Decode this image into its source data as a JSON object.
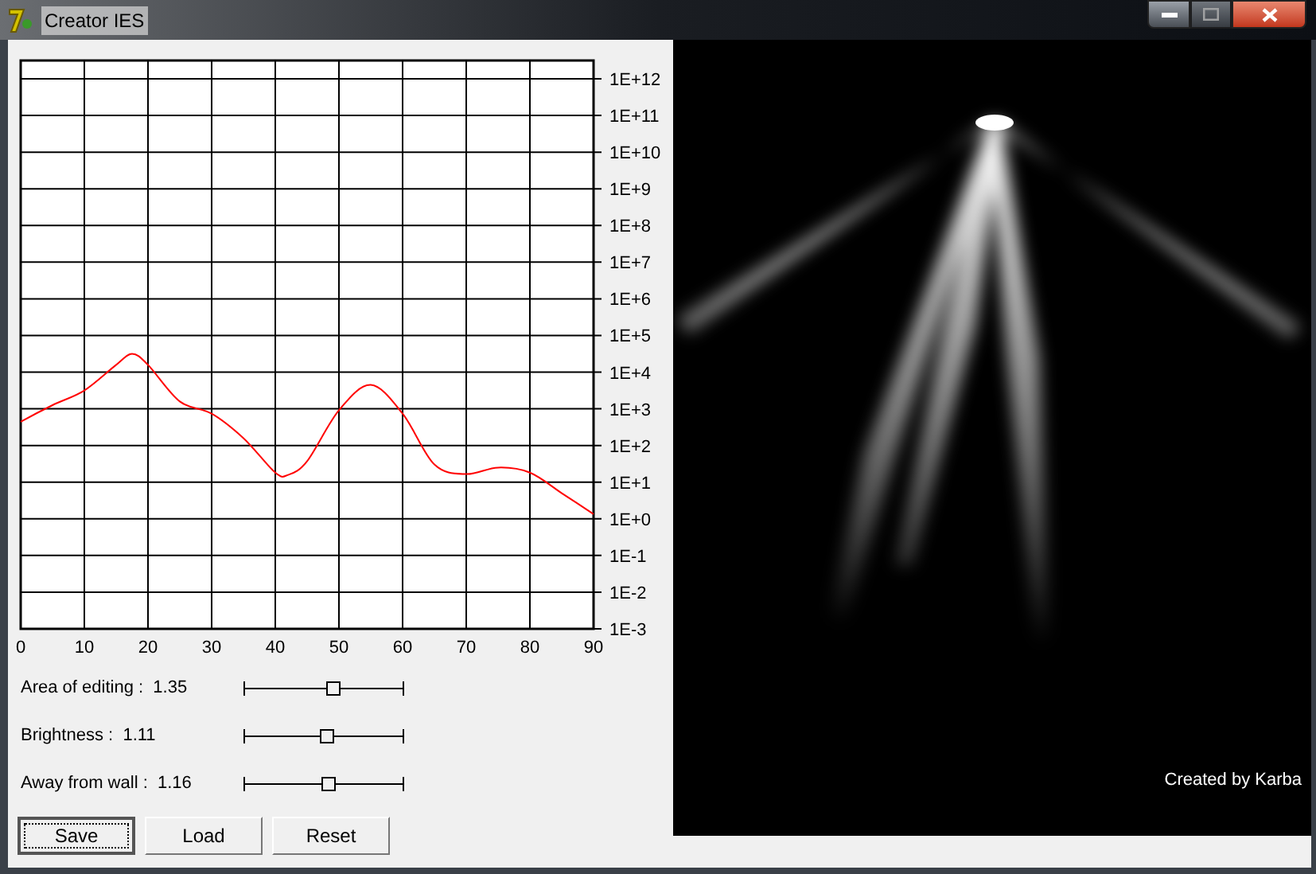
{
  "window": {
    "title": "Creator IES"
  },
  "title_buttons": [
    {
      "kind": "minimize"
    },
    {
      "kind": "maximize"
    },
    {
      "kind": "close"
    }
  ],
  "graph": {
    "x_labels": [
      "0",
      "10",
      "20",
      "30",
      "40",
      "50",
      "60",
      "70",
      "80",
      "90"
    ],
    "y_labels": [
      "1E+12",
      "1E+11",
      "1E+10",
      "1E+9",
      "1E+8",
      "1E+7",
      "1E+6",
      "1E+5",
      "1E+4",
      "1E+3",
      "1E+2",
      "1E+1",
      "1E+0",
      "1E-1",
      "1E-2",
      "1E-3"
    ]
  },
  "sliders": [
    {
      "label": "Area of editing :",
      "value": "1.35",
      "level": 0.56
    },
    {
      "label": "Brightness :",
      "value": "1.11",
      "level": 0.52
    },
    {
      "label": "Away from wall :",
      "value": "1.16",
      "level": 0.53
    }
  ],
  "buttons": [
    {
      "label": "Save",
      "focused": true
    },
    {
      "label": "Load",
      "focused": false
    },
    {
      "label": "Reset",
      "focused": false
    }
  ],
  "preview": {
    "caption": "Created by Karba"
  }
}
